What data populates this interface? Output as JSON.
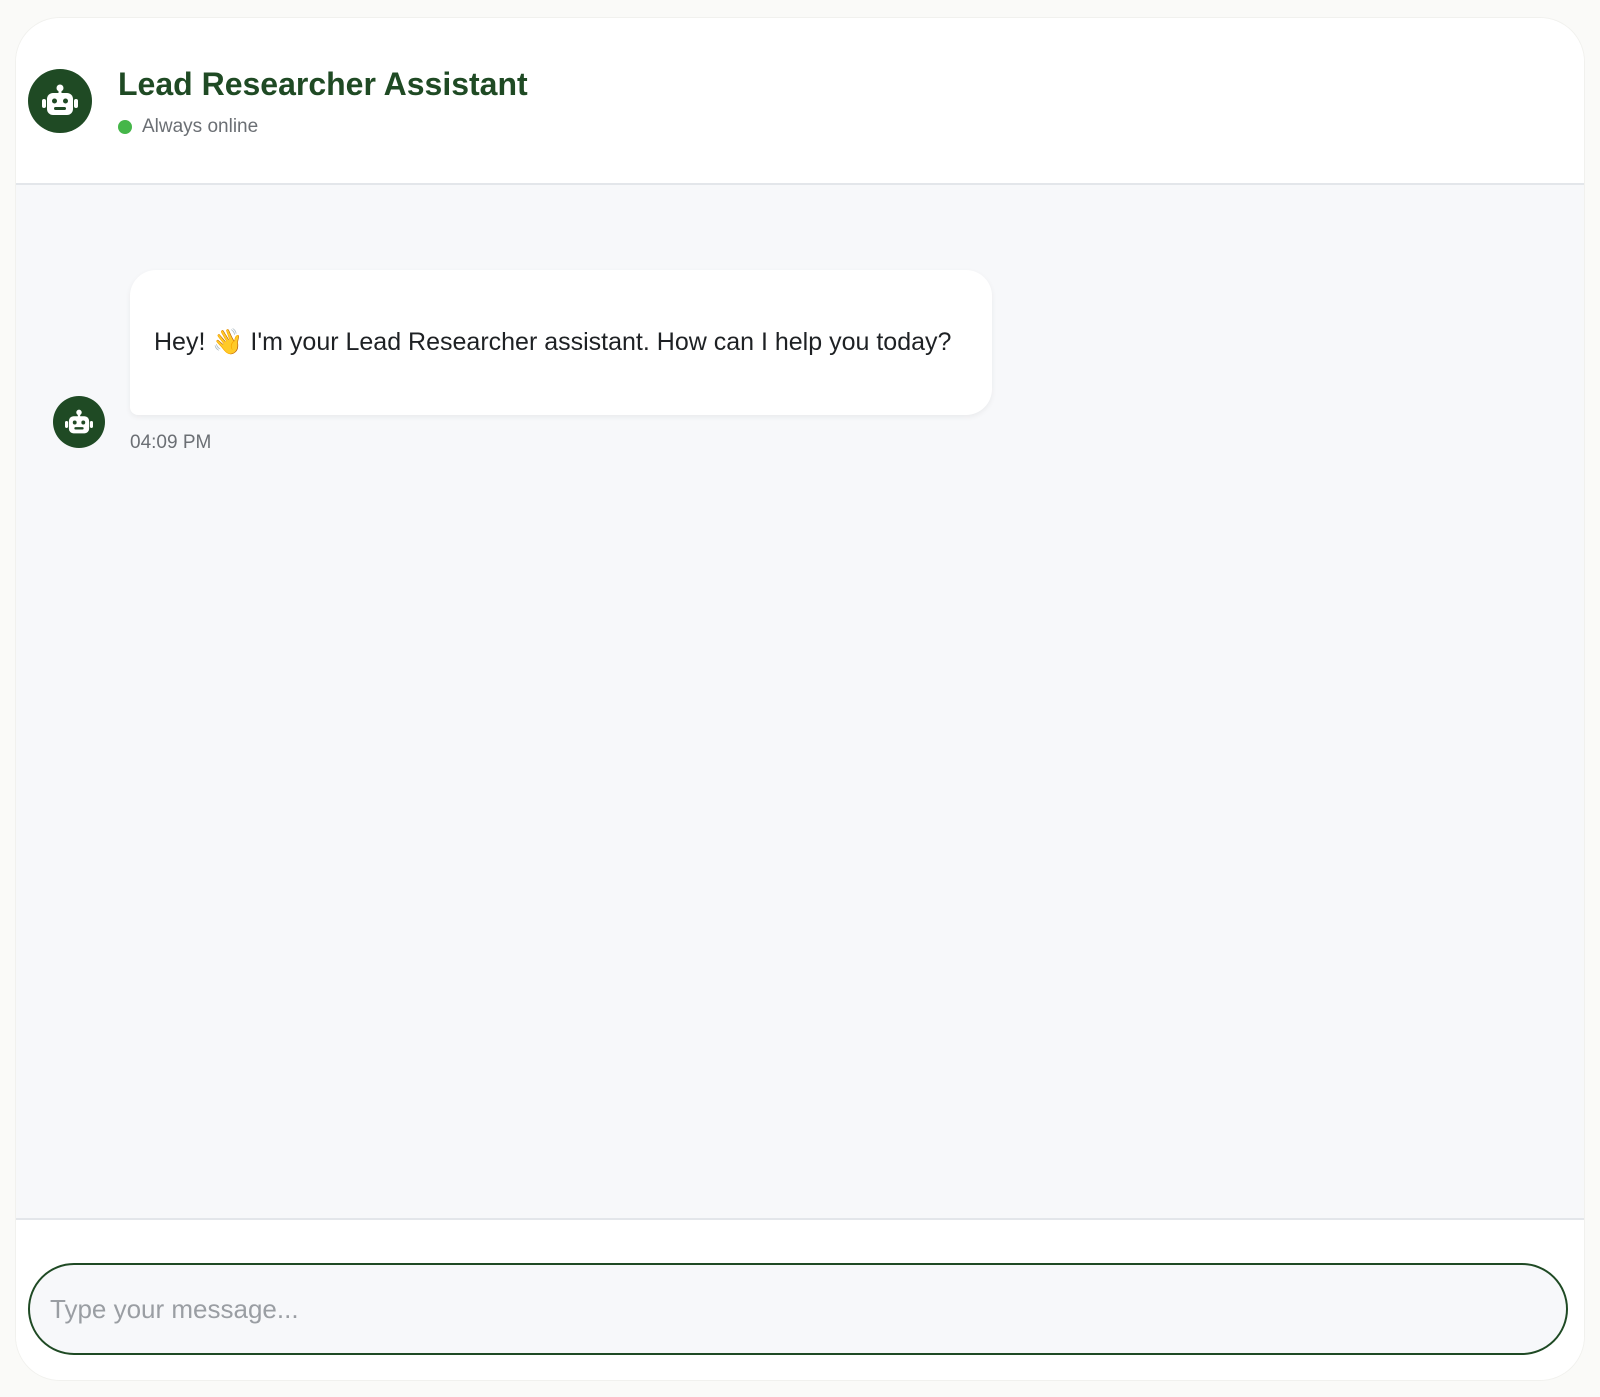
{
  "header": {
    "title": "Lead Researcher Assistant",
    "status_text": "Always online",
    "avatar_icon": "robot-icon",
    "status_color": "#45b649"
  },
  "messages": [
    {
      "sender": "assistant",
      "avatar_icon": "robot-icon",
      "text": "Hey! 👋 I'm your Lead Researcher assistant. How can I help you today?",
      "time": "04:09 PM"
    }
  ],
  "composer": {
    "placeholder": "Type your message...",
    "value": ""
  },
  "colors": {
    "brand": "#1f4a24",
    "chat_background": "#f7f8fa",
    "bubble_background": "#ffffff",
    "online": "#45b649"
  }
}
